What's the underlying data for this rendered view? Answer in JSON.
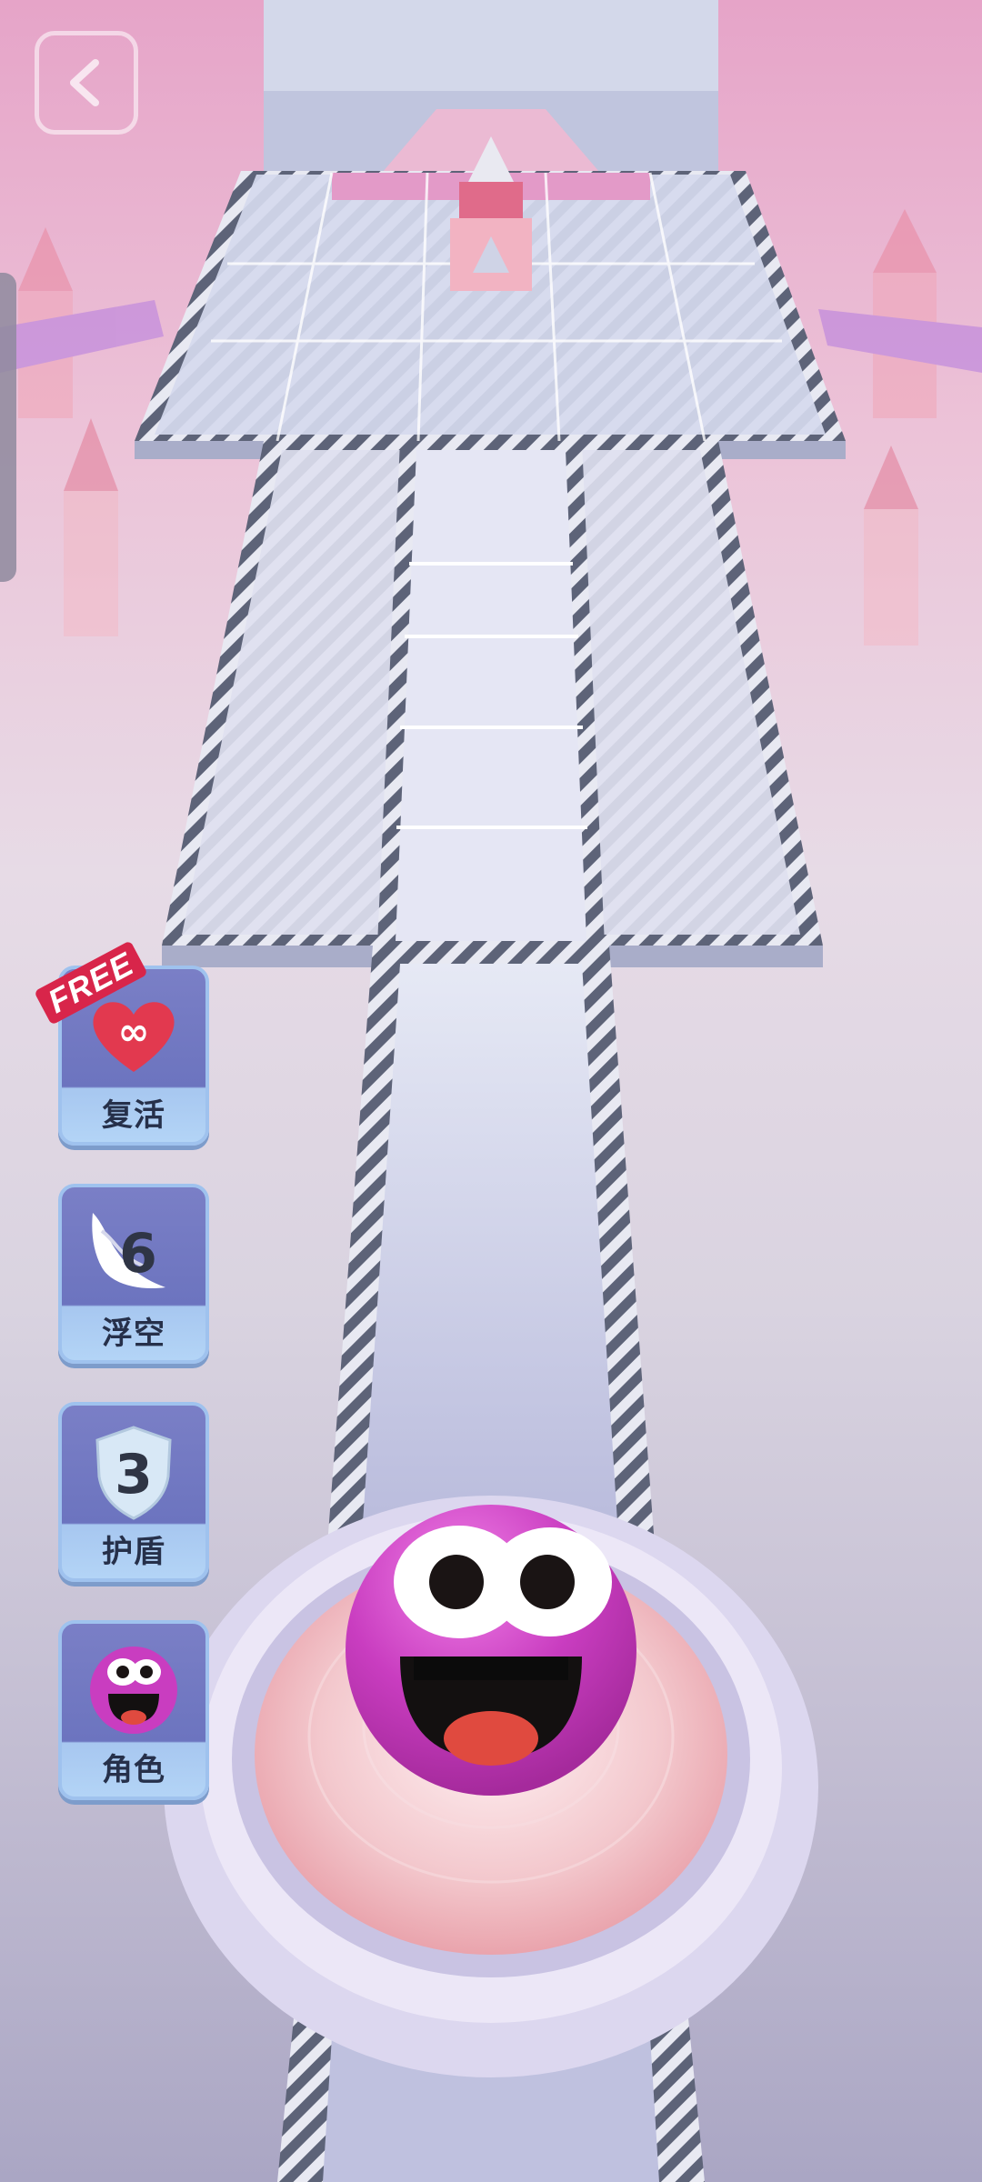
{
  "game": {
    "back_button_icon": "chevron-left-icon",
    "powerups": [
      {
        "id": "revive",
        "label": "复活",
        "icon": "infinity-heart-icon",
        "badge": "FREE",
        "symbol": "∞"
      },
      {
        "id": "float",
        "label": "浮空",
        "icon": "wing-icon",
        "count": "6"
      },
      {
        "id": "shield",
        "label": "护盾",
        "icon": "shield-icon",
        "count": "3"
      },
      {
        "id": "character",
        "label": "角色",
        "icon": "smiley-ball-icon"
      }
    ],
    "colors": {
      "ball": "#c93dc0",
      "track": "#c9cbe6",
      "stripe": "#5d6378",
      "heart": "#e2394f",
      "button_bg": "#6c74bf"
    }
  }
}
